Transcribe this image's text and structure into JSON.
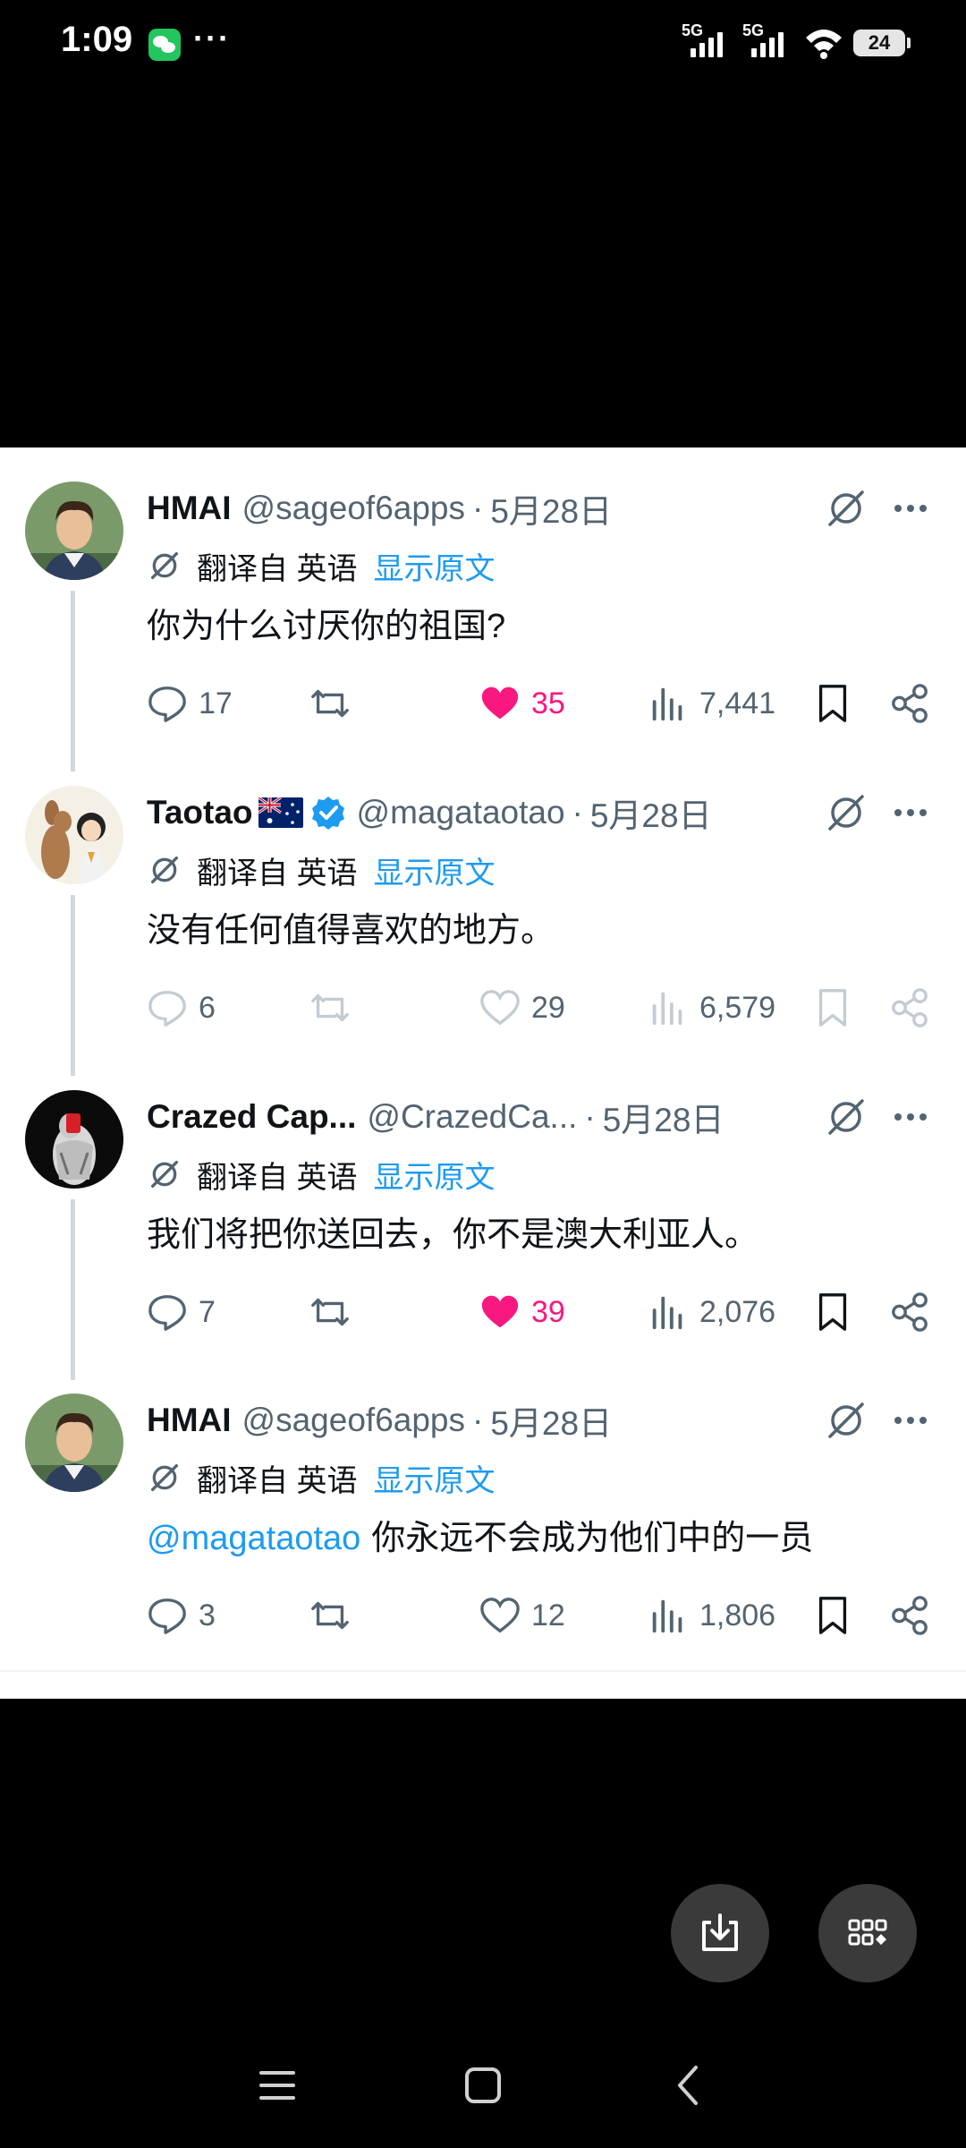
{
  "status_bar": {
    "time": "1:09",
    "dots": "···",
    "signal1": "5G",
    "signal2": "5G",
    "battery": "24"
  },
  "translate": {
    "label": "翻译自 英语",
    "show_original": "显示原文"
  },
  "tweets": [
    {
      "name": "HMAI",
      "handle": "@sageof6apps",
      "sep": "·",
      "date": "5月28日",
      "mention": "",
      "text": "你为什么讨厌你的祖国?",
      "replies": "17",
      "likes": "35",
      "views": "7,441"
    },
    {
      "name": "Taotao",
      "handle": "@magataotao",
      "sep": "·",
      "date": "5月28日",
      "mention": "",
      "text": "没有任何值得喜欢的地方。",
      "replies": "6",
      "likes": "29",
      "views": "6,579"
    },
    {
      "name": "Crazed Cap...",
      "handle": "@CrazedCa...",
      "sep": "·",
      "date": "5月28日",
      "mention": "",
      "text": "我们将把你送回去，你不是澳大利亚人。",
      "replies": "7",
      "likes": "39",
      "views": "2,076"
    },
    {
      "name": "HMAI",
      "handle": "@sageof6apps",
      "sep": "·",
      "date": "5月28日",
      "mention": "@magataotao",
      "text": "你永远不会成为他们中的一员",
      "replies": "3",
      "likes": "12",
      "views": "1,806"
    }
  ],
  "colors": {
    "accent": "#1d9bf0",
    "like": "#f91880",
    "muted": "#536471"
  }
}
